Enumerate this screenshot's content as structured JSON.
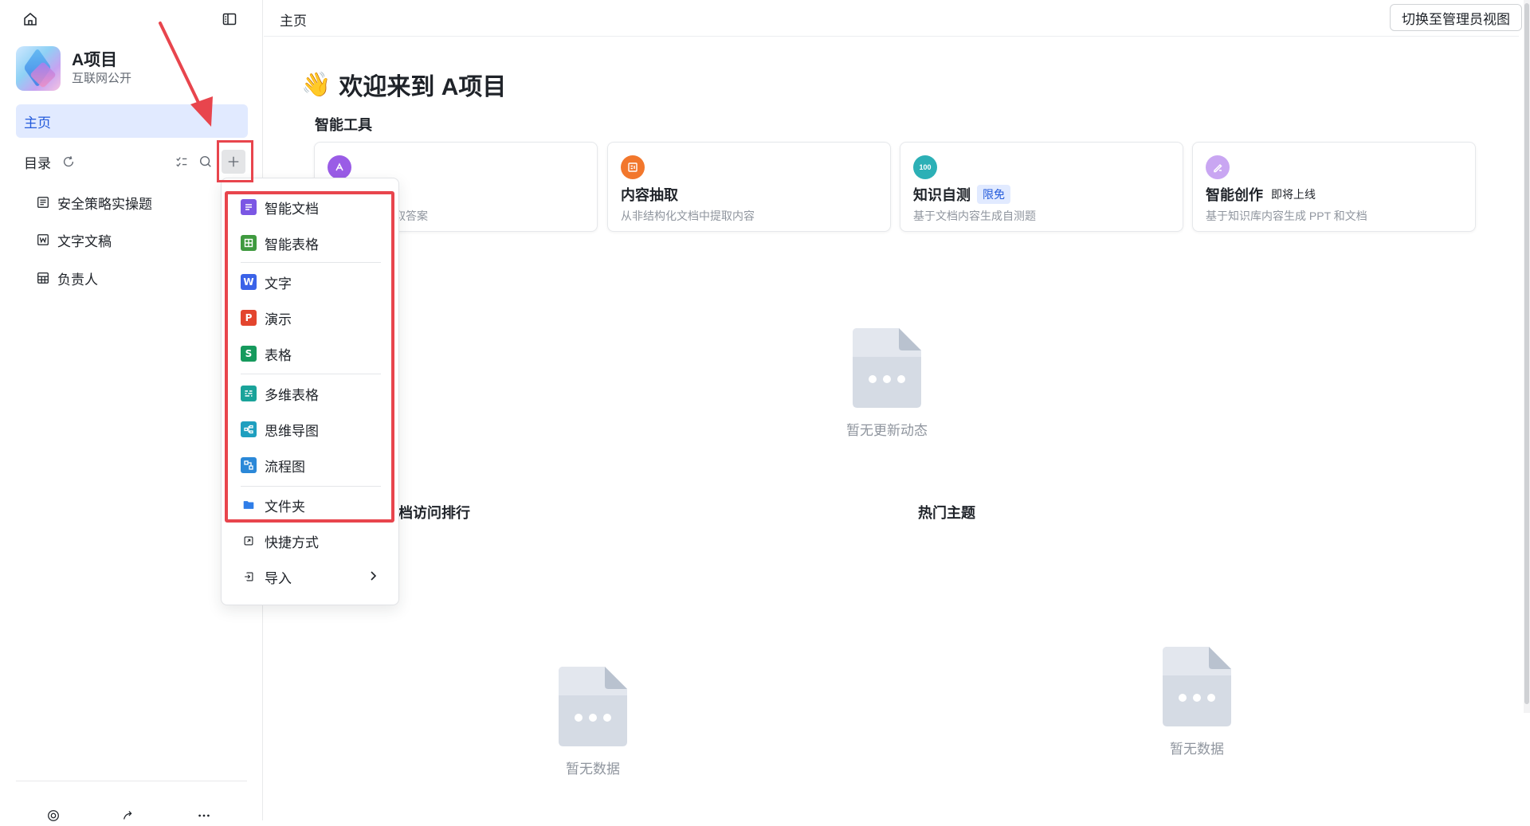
{
  "sidebar": {
    "project": {
      "name": "A项目",
      "subtitle": "互联网公开"
    },
    "nav_home": "主页",
    "catalog_label": "目录",
    "tree": [
      {
        "label": "安全策略实操题",
        "icon": "doc-icon"
      },
      {
        "label": "文字文稿",
        "icon": "word-doc-icon"
      },
      {
        "label": "负责人",
        "icon": "table-icon"
      }
    ]
  },
  "topbar": {
    "breadcrumb": "主页",
    "admin_button": "切换至管理员视图"
  },
  "main": {
    "welcome_emoji": "👋",
    "welcome_title": "欢迎来到 A项目",
    "tools_section": "智能工具",
    "tools": [
      {
        "name": "",
        "desc": "进行提问，获取答案",
        "icon_color": "#9a5ce6",
        "badge": ""
      },
      {
        "name": "内容抽取",
        "desc": "从非结构化文档中提取内容",
        "icon_color": "#f2772c",
        "badge": ""
      },
      {
        "name": "知识自测",
        "desc": "基于文档内容生成自测题",
        "icon_color": "#2cb0b6",
        "badge": "限免"
      },
      {
        "name": "智能创作",
        "desc": "基于知识库内容生成 PPT 和文档",
        "icon_color": "#c9a6f2",
        "badge": "即将上线"
      }
    ],
    "empty_updates": "暂无更新动态",
    "ranking_section": "档访问排行",
    "hot_section": "热门主题",
    "empty_ranking": "暂无数据",
    "empty_hot": "暂无数据"
  },
  "dropdown": {
    "items": [
      {
        "label": "智能文档",
        "icon": "smart-doc-icon",
        "color": "#7b57e4",
        "glyph": ""
      },
      {
        "label": "智能表格",
        "icon": "smart-sheet-icon",
        "color": "#3f9a3f",
        "glyph": ""
      },
      {
        "label": "文字",
        "icon": "word-icon",
        "color": "#3b63e8",
        "glyph": "W"
      },
      {
        "label": "演示",
        "icon": "presentation-icon",
        "color": "#e3452e",
        "glyph": "P"
      },
      {
        "label": "表格",
        "icon": "spreadsheet-icon",
        "color": "#169a5d",
        "glyph": "S"
      },
      {
        "label": "多维表格",
        "icon": "multi-table-icon",
        "color": "#1aa39a",
        "glyph": ""
      },
      {
        "label": "思维导图",
        "icon": "mindmap-icon",
        "color": "#1e9fbf",
        "glyph": ""
      },
      {
        "label": "流程图",
        "icon": "flowchart-icon",
        "color": "#2b88d8",
        "glyph": ""
      },
      {
        "label": "文件夹",
        "icon": "folder-icon",
        "color": "#2f7de8",
        "glyph": ""
      },
      {
        "label": "快捷方式",
        "icon": "shortcut-icon",
        "color": "#ffffff",
        "glyph": ""
      },
      {
        "label": "导入",
        "icon": "import-icon",
        "color": "#ffffff",
        "glyph": ""
      }
    ]
  },
  "colors": {
    "accent": "#245bdb",
    "highlight_red": "#e8454d",
    "nav_active_bg": "#e1eaff"
  }
}
